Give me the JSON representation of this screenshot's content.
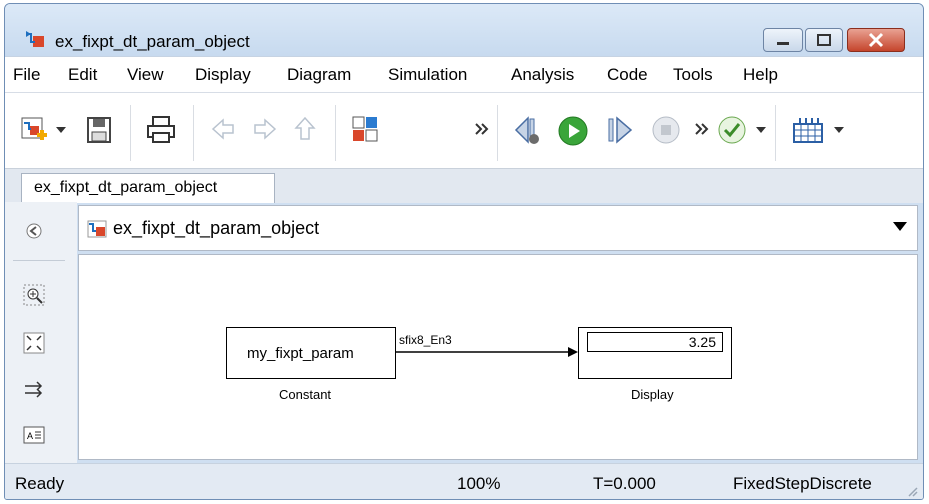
{
  "window": {
    "title": "ex_fixpt_dt_param_object"
  },
  "menu": [
    "File",
    "Edit",
    "View",
    "Display",
    "Diagram",
    "Simulation",
    "Analysis",
    "Code",
    "Tools",
    "Help"
  ],
  "tab": {
    "label": "ex_fixpt_dt_param_object"
  },
  "address": {
    "path": "ex_fixpt_dt_param_object"
  },
  "blocks": {
    "constant": {
      "value": "my_fixpt_param",
      "label": "Constant"
    },
    "display": {
      "value": "3.25",
      "label": "Display"
    },
    "signal": {
      "type": "sfix8_En3"
    }
  },
  "status": {
    "state": "Ready",
    "zoom": "100%",
    "time": "T=0.000",
    "solver": "FixedStepDiscrete"
  }
}
